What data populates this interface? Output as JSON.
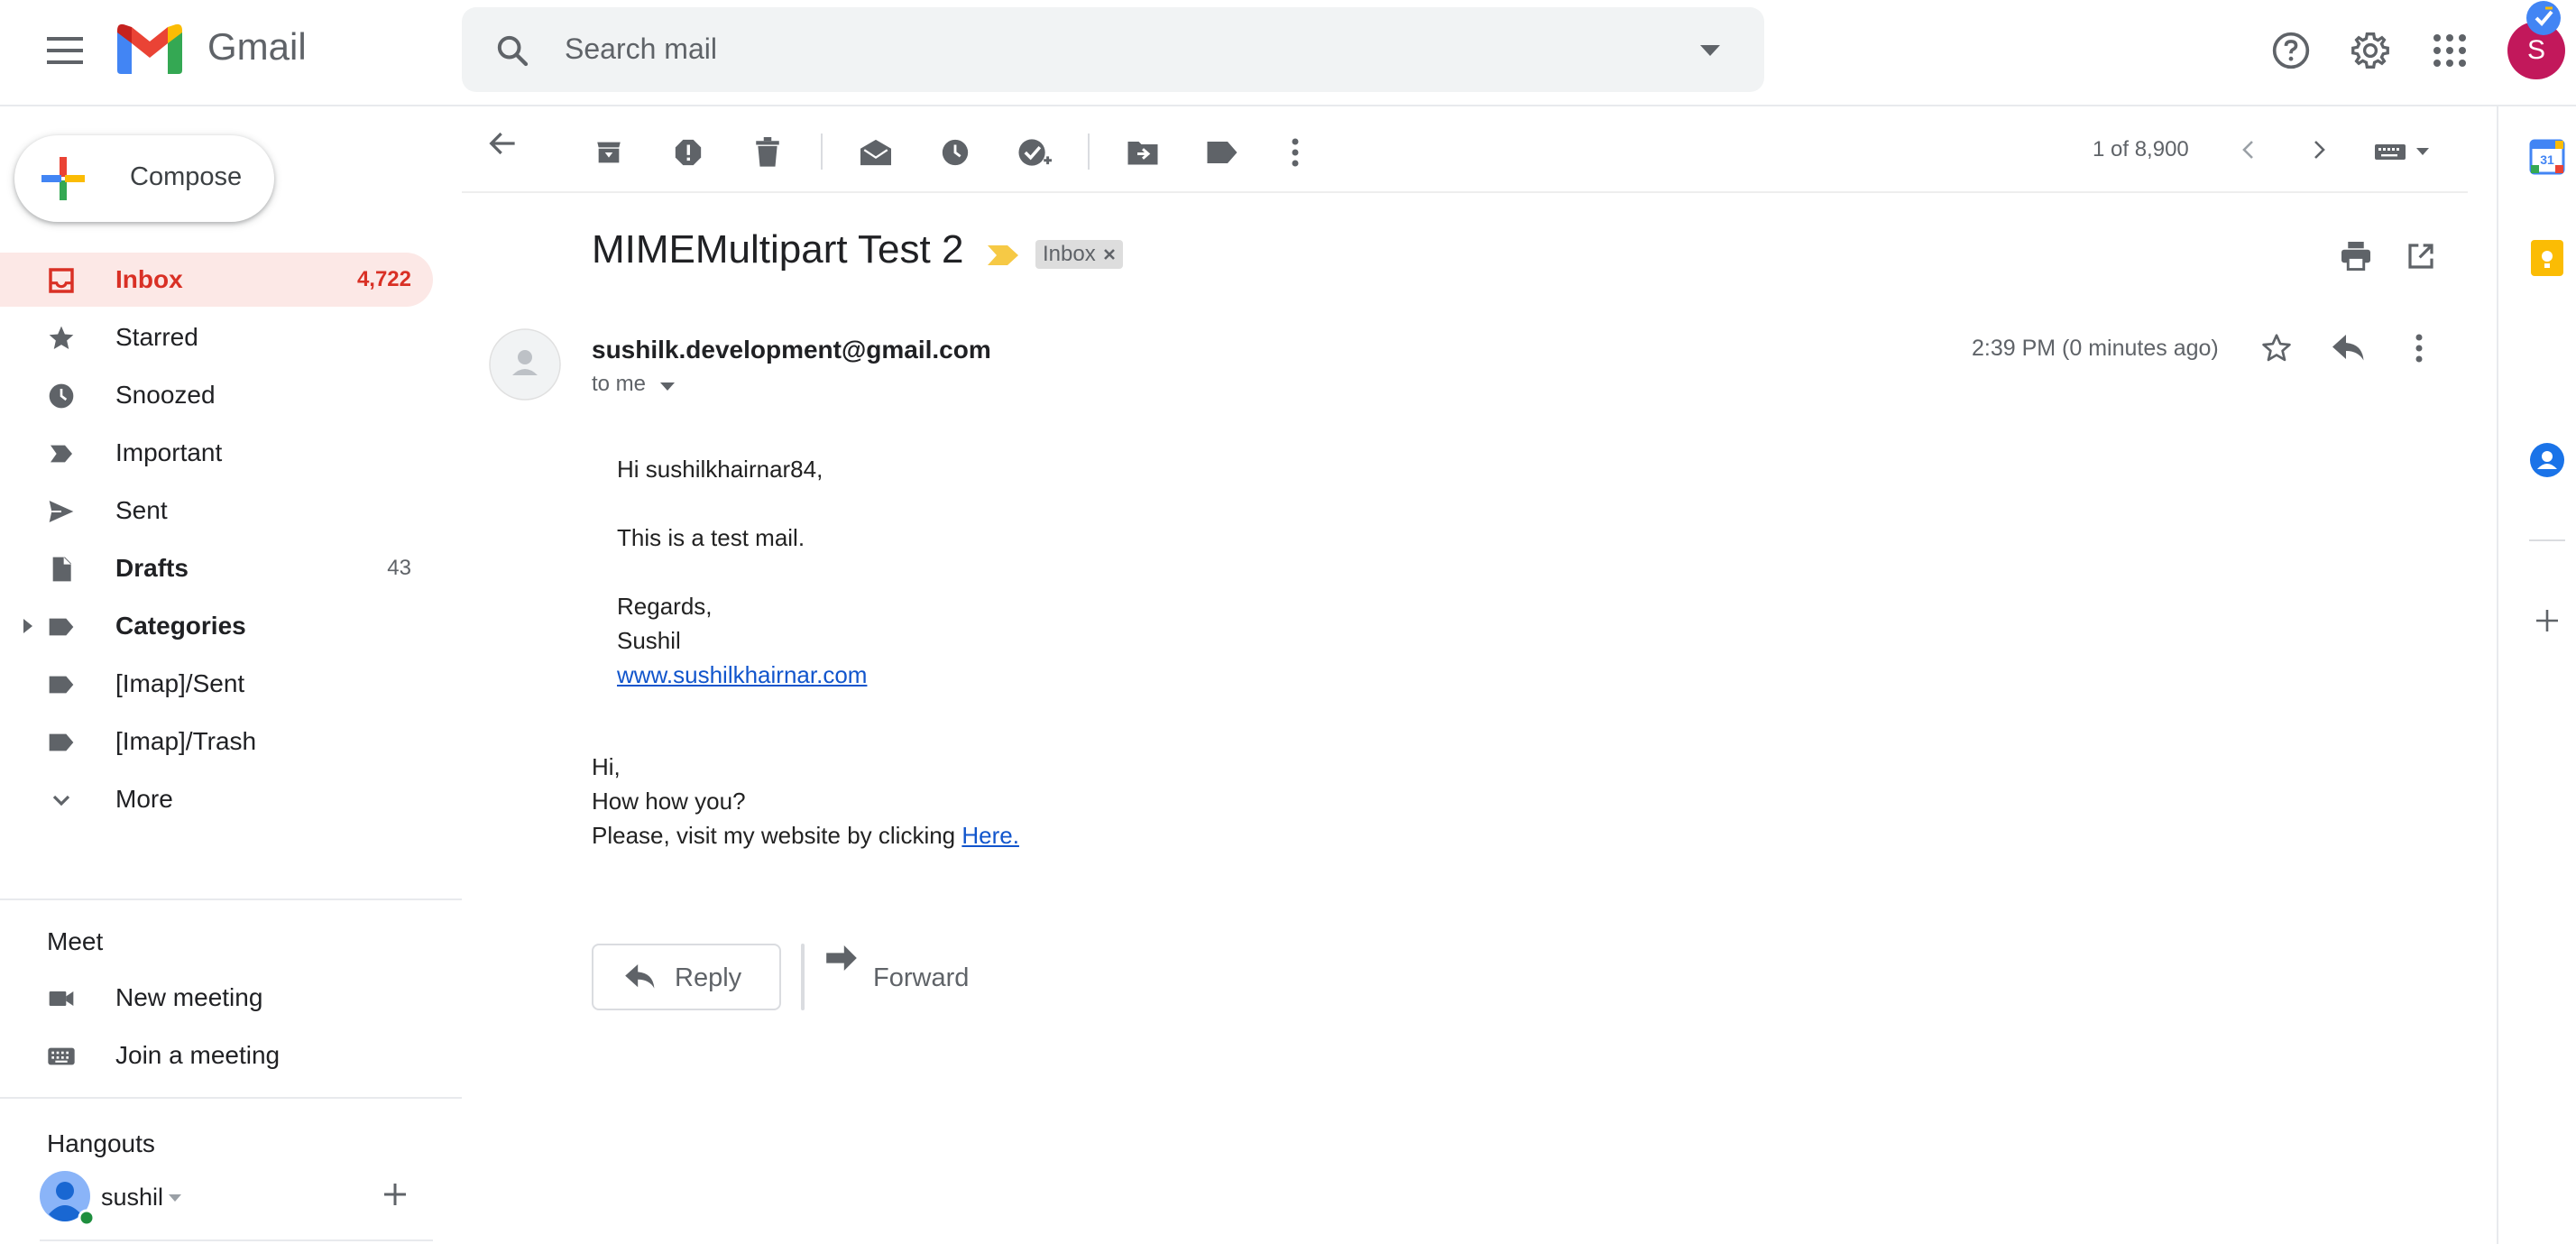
{
  "app": {
    "name": "Gmail"
  },
  "header": {
    "search_placeholder": "Search mail",
    "avatar_initial": "S"
  },
  "sidebar": {
    "compose_label": "Compose",
    "items": [
      {
        "label": "Inbox",
        "count": "4,722",
        "icon": "inbox-icon"
      },
      {
        "label": "Starred",
        "count": "",
        "icon": "star-icon"
      },
      {
        "label": "Snoozed",
        "count": "",
        "icon": "clock-icon"
      },
      {
        "label": "Important",
        "count": "",
        "icon": "important-icon"
      },
      {
        "label": "Sent",
        "count": "",
        "icon": "send-icon"
      },
      {
        "label": "Drafts",
        "count": "43",
        "icon": "draft-icon"
      },
      {
        "label": "Categories",
        "count": "",
        "icon": "label-icon"
      },
      {
        "label": "[Imap]/Sent",
        "count": "",
        "icon": "label-icon"
      },
      {
        "label": "[Imap]/Trash",
        "count": "",
        "icon": "label-icon"
      },
      {
        "label": "More",
        "count": "",
        "icon": "chevron-down-icon"
      }
    ],
    "meet": {
      "title": "Meet",
      "new_meeting": "New meeting",
      "join_meeting": "Join a meeting"
    },
    "hangouts": {
      "title": "Hangouts",
      "user": "sushil"
    }
  },
  "toolbar": {
    "pagination": "1 of 8,900"
  },
  "email": {
    "subject": "MIMEMultipart Test 2",
    "label_chip": "Inbox",
    "sender": "sushilk.development@gmail.com",
    "to": "to me",
    "time": "2:39 PM (0 minutes ago)",
    "body1": {
      "greeting": "Hi sushilkhairnar84,",
      "line": "This is a test mail.",
      "regards": "Regards,",
      "name": "Sushil",
      "link": "www.sushilkhairnar.com"
    },
    "body2": {
      "hi": "Hi,",
      "how": "How how you?",
      "visit": "Please, visit my website by clicking ",
      "here": "Here."
    }
  },
  "actions": {
    "reply": "Reply",
    "forward": "Forward"
  },
  "colors": {
    "accent_red": "#d93025",
    "inbox_active_bg": "#fce8e6",
    "avatar": "#c2185b",
    "link": "#1155cc"
  }
}
